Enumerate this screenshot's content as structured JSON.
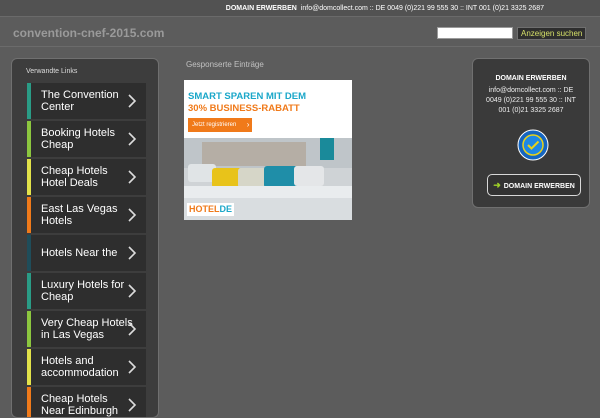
{
  "topbar": {
    "buy_label": "DOMAIN ERWERBEN",
    "contact": "info@domcollect.com :: DE 0049 (0)221 99 555 30 :: INT 001 (0)21 3325 2687"
  },
  "header": {
    "site_title": "convention-cnef-2015.com",
    "search_value": "",
    "search_button": "Anzeigen suchen"
  },
  "sidebar": {
    "title": "Verwandte Links",
    "items": [
      {
        "label": "The Convention Center",
        "color": "#2a9c86"
      },
      {
        "label": "Booking Hotels Cheap",
        "color": "#8cc63f"
      },
      {
        "label": "Cheap Hotels Hotel Deals",
        "color": "#e2e24a"
      },
      {
        "label": "East Las Vegas Hotels",
        "color": "#f07a1a"
      },
      {
        "label": "Hotels Near the",
        "color": "#1f4d5a"
      },
      {
        "label": "Luxury Hotels for Cheap",
        "color": "#2a9c86"
      },
      {
        "label": "Very Cheap Hotels in Las Vegas",
        "color": "#8cc63f"
      },
      {
        "label": "Hotels and accommodation",
        "color": "#e2e24a"
      },
      {
        "label": "Cheap Hotels Near Edinburgh",
        "color": "#f07a1a"
      }
    ]
  },
  "main": {
    "sponsored_title": "Gesponserte Einträge",
    "ad": {
      "line1": "SMART SPAREN MIT DEM",
      "line2": "30% BUSINESS-RABATT",
      "cta": "Jetzt registrieren",
      "logo_hotel": "HOTEL",
      "logo_de": "DE"
    }
  },
  "domain_box": {
    "title": "DOMAIN ERWERBEN",
    "contact": "info@domcollect.com :: DE 0049 (0)221 99 555 30 :: INT 001 (0)21 3325 2687",
    "button": "DOMAIN ERWERBEN"
  },
  "colors": {
    "background": "#5c5c5c",
    "panel": "#3d3d3d",
    "accent_green": "#9ed028",
    "ad_blue": "#1aa7c9",
    "ad_orange": "#f07a1a"
  }
}
